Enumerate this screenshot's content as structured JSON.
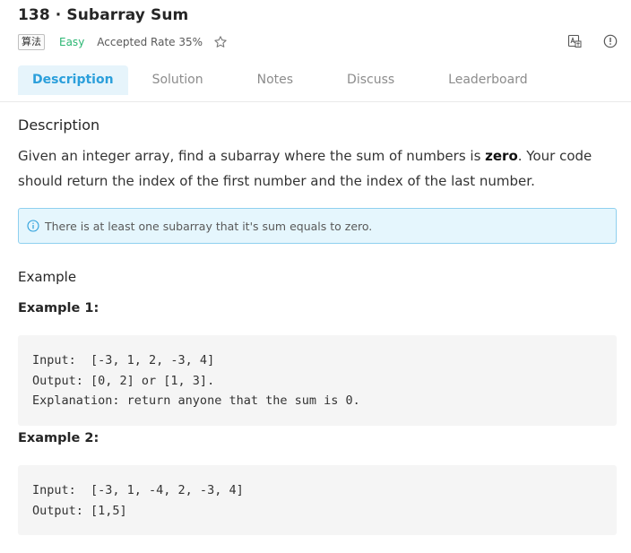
{
  "problem": {
    "title": "138 · Subarray Sum",
    "tag": "算法",
    "difficulty": "Easy",
    "accepted_rate": "Accepted Rate 35%"
  },
  "icons": {
    "star": "star-outline-icon",
    "translate": "translate-icon",
    "info": "info-circle-icon"
  },
  "tabs": [
    {
      "label": "Description",
      "active": true
    },
    {
      "label": "Solution",
      "active": false
    },
    {
      "label": "Notes",
      "active": false
    },
    {
      "label": "Discuss",
      "active": false
    },
    {
      "label": "Leaderboard",
      "active": false
    }
  ],
  "description": {
    "heading": "Description",
    "text_before": "Given an integer array, find a subarray where the sum of numbers is ",
    "text_bold": "zero",
    "text_after": ". Your code should return the index of the first number and the index of the last number.",
    "note": "There is at least one subarray that it's sum equals to zero."
  },
  "examples": {
    "heading": "Example",
    "ex1": {
      "title": "Example 1:",
      "lines": [
        "Input:  [-3, 1, 2, -3, 4]",
        "Output: [0, 2] or [1, 3].",
        "Explanation: return anyone that the sum is 0."
      ]
    },
    "ex2": {
      "title": "Example 2:",
      "lines": [
        "Input:  [-3, 1, -4, 2, -3, 4]",
        "Output: [1,5]"
      ]
    }
  },
  "colors": {
    "accent": "#2b9fdb",
    "easy": "#2bb673",
    "note_bg": "#e5f6fd",
    "note_border": "#8fd0ef"
  }
}
